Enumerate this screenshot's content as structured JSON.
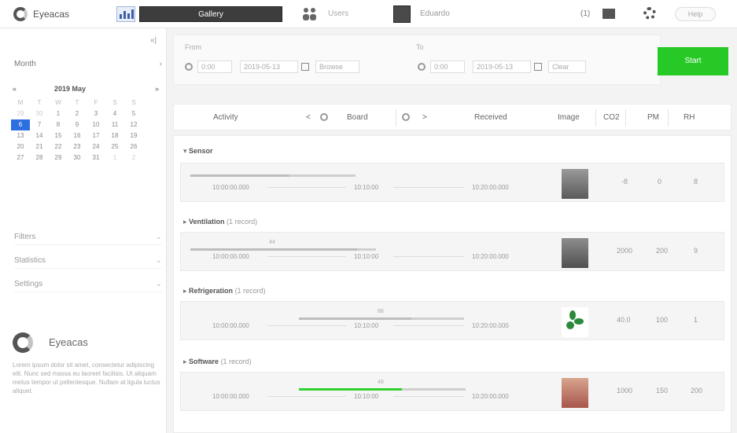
{
  "topbar": {
    "brand": "Eyeacas",
    "active_tab": "Gallery",
    "users_label": "Users",
    "user_name": "Eduardo",
    "count": "(1)",
    "help_label": "Help"
  },
  "sidebar": {
    "collapse_label": "«|",
    "month_label": "Month",
    "calendar": {
      "title": "2019 May",
      "prev": "«",
      "next": "»",
      "weekdays": [
        "M",
        "T",
        "W",
        "T",
        "F",
        "S",
        "S"
      ],
      "weeks": [
        [
          "29",
          "30",
          "1",
          "2",
          "3",
          "4",
          "5"
        ],
        [
          "6",
          "7",
          "8",
          "9",
          "10",
          "11",
          "12"
        ],
        [
          "13",
          "14",
          "15",
          "16",
          "17",
          "18",
          "19"
        ],
        [
          "20",
          "21",
          "22",
          "23",
          "24",
          "25",
          "26"
        ],
        [
          "27",
          "28",
          "29",
          "30",
          "31",
          "1",
          "2"
        ]
      ],
      "today_index": 7
    },
    "sections": [
      "Filters",
      "Statistics",
      "Settings"
    ],
    "promo_title": "Eyeacas",
    "promo_text": "Lorem ipsum dolor sit amet, consectetur adipiscing elit. Nunc sed massa eu laoreet facilisis. Ut aliquam metus tempor ut pellentesque. Nullam at ligula luctus aliquet."
  },
  "filters": {
    "from_label": "From",
    "from_time": "0:00",
    "from_date": "2019-05-13",
    "from_button": "Browse",
    "to_label": "To",
    "to_time": "0:00",
    "to_date": "2019-05-13",
    "to_button": "Clear",
    "start_label": "Start"
  },
  "header": {
    "col_name": "Activity",
    "col_prev": "<",
    "col_mid": "Board",
    "col_next": ">",
    "col_date": "Received",
    "col_image": "Image",
    "col_a": "CO2",
    "col_b": "PM",
    "col_c": "RH"
  },
  "groups": [
    {
      "name": "Sensor",
      "count": "",
      "pct": "",
      "time_start": "10:00:00.000",
      "time_mid": "10:10:00",
      "time_end": "10:20:00.000",
      "progress": 0.6,
      "val_a": "-8",
      "val_b": "0",
      "val_c": "8"
    },
    {
      "name": "Ventilation",
      "count": "(1 record)",
      "pct": "44",
      "time_start": "10:00:00.000",
      "time_mid": "10:10:00",
      "time_end": "10:20:00.000",
      "progress": 0.9,
      "val_a": "2000",
      "val_b": "200",
      "val_c": "9"
    },
    {
      "name": "Refrigeration",
      "count": "(1 record)",
      "pct": "88",
      "time_start": "10:00:00.000",
      "time_mid": "10:10:00",
      "time_end": "10:20:00.000",
      "progress": 0.68,
      "val_a": "40.0",
      "val_b": "100",
      "val_c": "1"
    },
    {
      "name": "Software",
      "count": "(1 record)",
      "pct": "48",
      "time_start": "10:00:00.000",
      "time_mid": "10:10:00",
      "time_end": "10:20:00.000",
      "progress": 0.62,
      "val_a": "1000",
      "val_b": "150",
      "val_c": "200"
    }
  ]
}
